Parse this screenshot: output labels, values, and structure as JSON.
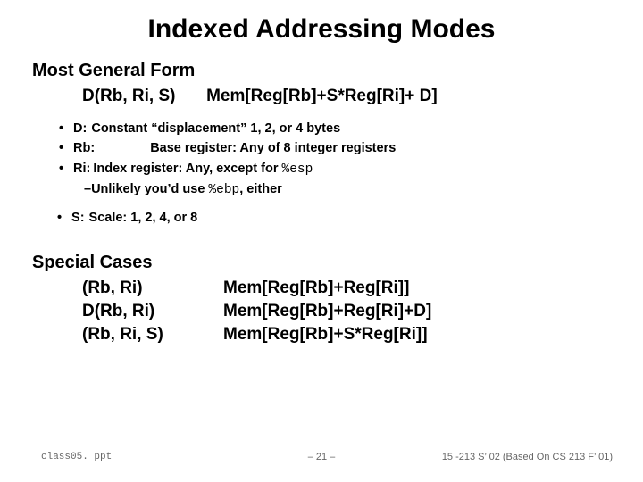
{
  "title": "Indexed Addressing Modes",
  "general": {
    "heading": "Most General Form",
    "lhs": "D(Rb, Ri, S)",
    "rhs": "Mem[Reg[Rb]+S*Reg[Ri]+ D]"
  },
  "bullets": {
    "d": {
      "label": "D:",
      "desc": "Constant “displacement” 1, 2, or 4 bytes"
    },
    "rb": {
      "label": "Rb:",
      "desc": "Base register: Any of 8 integer registers"
    },
    "ri": {
      "label": "Ri:",
      "desc_before": "Index register: Any, except for ",
      "reg": "%esp"
    },
    "ri_sub": {
      "before": "Unlikely you’d use ",
      "reg": "%ebp",
      "after": ", either"
    },
    "s": {
      "label": "S:",
      "desc": "Scale: 1, 2, 4, or 8"
    }
  },
  "special": {
    "heading": "Special Cases",
    "rows": [
      {
        "lhs": "(Rb, Ri)",
        "rhs": "Mem[Reg[Rb]+Reg[Ri]]"
      },
      {
        "lhs": "D(Rb, Ri)",
        "rhs": "Mem[Reg[Rb]+Reg[Ri]+D]"
      },
      {
        "lhs": "(Rb, Ri, S)",
        "rhs": "Mem[Reg[Rb]+S*Reg[Ri]]"
      }
    ]
  },
  "footer": {
    "left": "class05. ppt",
    "center": "– 21 –",
    "right": "15 -213 S’ 02 (Based On CS 213 F’ 01)"
  }
}
